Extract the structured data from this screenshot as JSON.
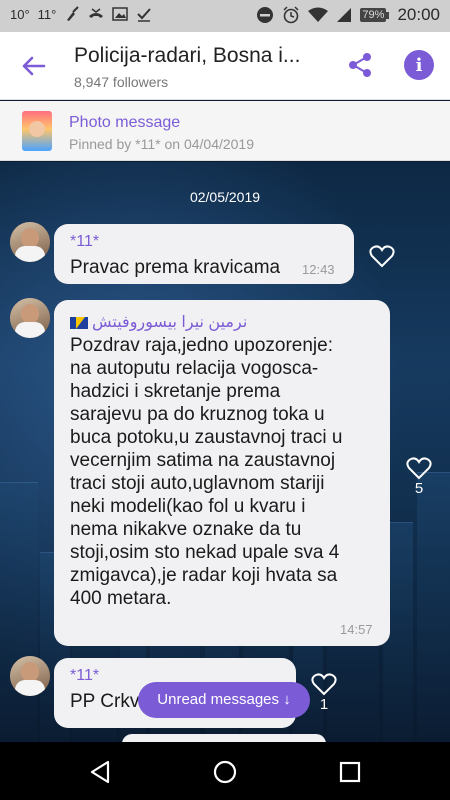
{
  "status_bar": {
    "left_items": [
      "10°",
      "11°"
    ],
    "battery": "79%",
    "time": "20:00"
  },
  "header": {
    "title": "Policija-radari, Bosna i...",
    "followers": "8,947 followers"
  },
  "pinned": {
    "title": "Photo message",
    "subtitle": "Pinned by *11* on 04/04/2019"
  },
  "chat": {
    "date_separator": "02/05/2019",
    "messages": [
      {
        "sender": "*11*",
        "lines": [
          "Pravac prema kravicama"
        ],
        "time": "12:43",
        "likes": ""
      },
      {
        "sender": "نرمين نيرا بيسوروفيتش",
        "lines": [
          "Pozdrav raja,jedno upozorenje:",
          "na autoputu relacija vogosca-",
          "hadzici i skretanje prema",
          "sarajevu pa do kruznog toka u",
          "buca potoku,u zaustavnoj traci u",
          "vecernjim satima na zaustavnoj",
          "traci stoji auto,uglavnom stariji",
          "neki modeli(kao fol u kvaru i",
          "nema nikakve oznake da tu",
          "stoji,osim sto nekad upale sva 4",
          "zmigavca),je radar koji hvata sa",
          "400 metara."
        ],
        "time": "14:57",
        "likes": "5"
      },
      {
        "sender": "*11*",
        "lines": [
          "PP Crkv"
        ],
        "time": "",
        "likes": "1"
      }
    ],
    "unread_label": "Unread messages ↓"
  },
  "colors": {
    "accent": "#7b5cd6",
    "bubble": "#f1f1f3"
  },
  "icons": [
    "back-arrow-icon",
    "share-icon",
    "info-icon",
    "heart-icon",
    "nav-back-icon",
    "nav-home-icon",
    "nav-recents-icon"
  ]
}
